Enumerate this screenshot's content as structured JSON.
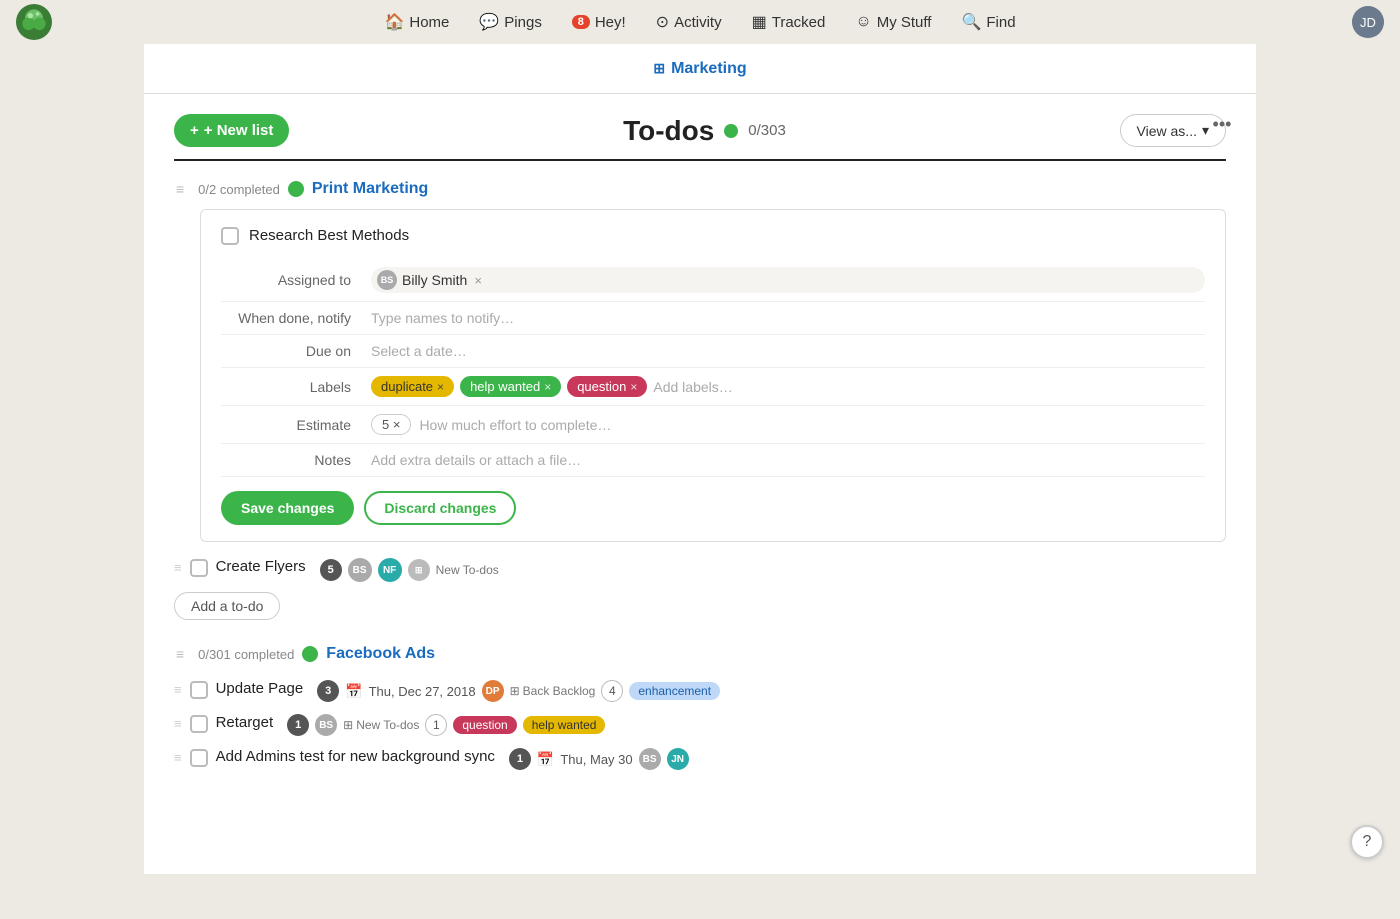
{
  "nav": {
    "home_label": "Home",
    "pings_label": "Pings",
    "hey_label": "Hey!",
    "hey_badge": "8",
    "activity_label": "Activity",
    "tracked_label": "Tracked",
    "mystuff_label": "My Stuff",
    "find_label": "Find"
  },
  "project": {
    "title": "Marketing"
  },
  "todos": {
    "title": "To-dos",
    "status_count": "0/303",
    "new_list_label": "+ New list",
    "view_as_label": "View as..."
  },
  "print_marketing": {
    "title": "Print Marketing",
    "completed_label": "0/2 completed",
    "expanded_item": {
      "title": "Research Best Methods",
      "assigned_to_label": "Assigned to",
      "assignee": "Billy Smith",
      "when_done_label": "When done, notify",
      "notify_placeholder": "Type names to notify…",
      "due_on_label": "Due on",
      "due_placeholder": "Select a date…",
      "labels_label": "Labels",
      "labels": [
        {
          "text": "duplicate",
          "color": "yellow"
        },
        {
          "text": "help wanted",
          "color": "green"
        },
        {
          "text": "question",
          "color": "pink"
        }
      ],
      "add_labels_placeholder": "Add labels…",
      "estimate_label": "Estimate",
      "estimate_value": "5 ×",
      "effort_placeholder": "How much effort to complete…",
      "notes_label": "Notes",
      "notes_placeholder": "Add extra details or attach a file…",
      "save_label": "Save changes",
      "discard_label": "Discard changes"
    },
    "items": [
      {
        "text": "Create Flyers",
        "count": "5",
        "assignees": [
          "BS",
          "NF"
        ],
        "list_tag": "New To-dos",
        "checked": false
      }
    ],
    "add_todo_label": "Add a to-do"
  },
  "facebook_ads": {
    "title": "Facebook Ads",
    "completed_label": "0/301 completed",
    "items": [
      {
        "text": "Update Page",
        "count": "3",
        "due": "Thu, Dec 27, 2018",
        "assignee": "David P.",
        "list_tag": "Back Backlog",
        "num": "4",
        "tag": "enhancement",
        "checked": false
      },
      {
        "text": "Retarget",
        "count": "1",
        "assignee": "Billy S.",
        "list_tag": "New To-dos",
        "num": "1",
        "tags": [
          "question",
          "help wanted"
        ],
        "checked": false
      },
      {
        "text": "Add Admins test for new background sync",
        "count": "1",
        "due": "Thu, May 30",
        "assignee": "Billy S.",
        "assignee2": "Jalen N.",
        "checked": false
      }
    ]
  }
}
